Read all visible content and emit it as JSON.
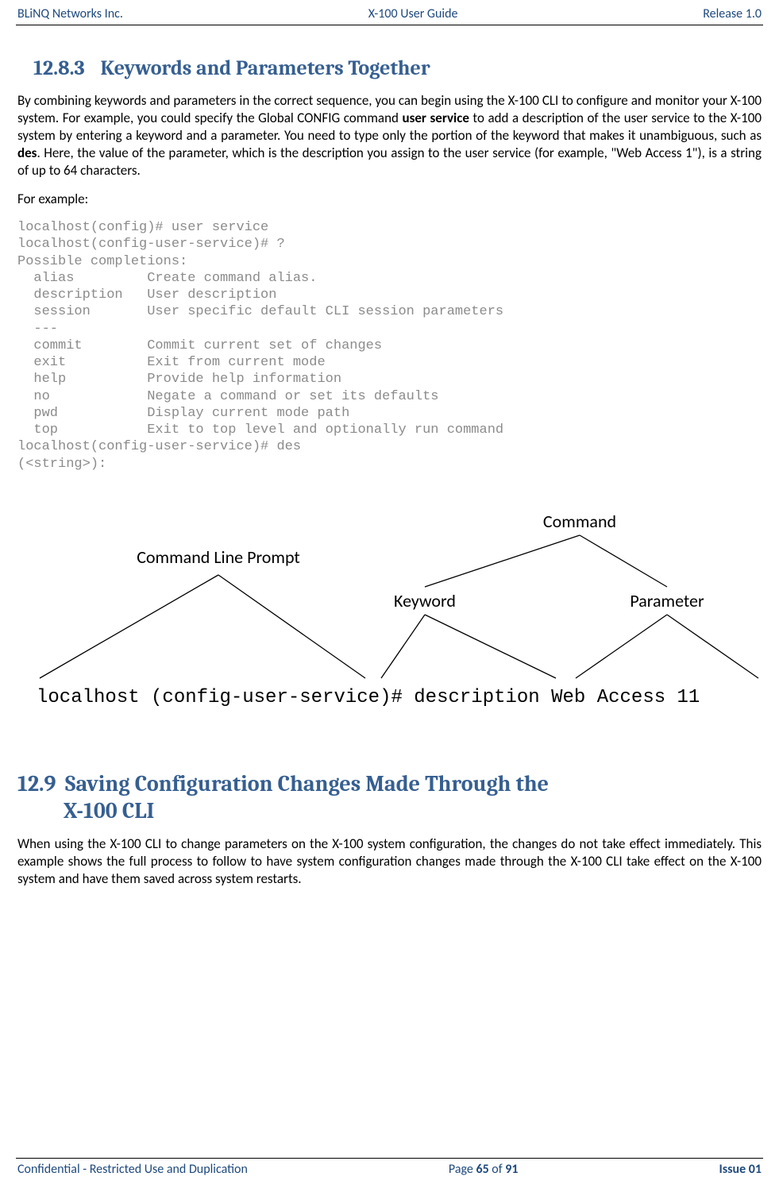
{
  "header": {
    "left": "BLiNQ Networks Inc.",
    "center": "X-100 User Guide",
    "right": "Release 1.0"
  },
  "section1": {
    "number": "12.8.3",
    "title": "Keywords and Parameters Together",
    "p1_a": "By combining keywords and parameters in the correct sequence, you can begin using the X-100 CLI to configure and monitor your X-100 system. For example, you could specify the Global CONFIG command ",
    "p1_b": "user service",
    "p1_c": " to add a description of the user service to the X-100 system by entering a keyword and a parameter. You need to type only the portion of the keyword that makes it unambiguous, such as ",
    "p1_d": "des",
    "p1_e": ". Here, the value of the parameter, which is the description you assign to the user service (for example, \"Web Access 1\"), is a string of up to 64 characters.",
    "p2": "For example:"
  },
  "cli_block": "localhost(config)# user service\nlocalhost(config-user-service)# ?\nPossible completions:\n  alias         Create command alias.\n  description   User description\n  session       User specific default CLI session parameters\n  ---\n  commit        Commit current set of changes\n  exit          Exit from current mode\n  help          Provide help information\n  no            Negate a command or set its defaults\n  pwd           Display current mode path\n  top           Exit to top level and optionally run command\nlocalhost(config-user-service)# des\n(<string>):",
  "diagram": {
    "label_prompt": "Command Line Prompt",
    "label_command": "Command",
    "label_keyword": "Keyword",
    "label_parameter": "Parameter",
    "cli_text": "localhost (config-user-service)# description Web Access 11"
  },
  "section2": {
    "number": "12.9",
    "title_line1": "Saving Configuration Changes Made Through the",
    "title_line2": "X-100 CLI",
    "p1": "When using the X-100 CLI to change parameters on the X-100 system configuration, the changes do not take effect immediately. This example shows the full process to follow to have system configuration changes made through the X-100 CLI take effect on the X-100 system and have them saved across system restarts."
  },
  "footer": {
    "left": "Confidential - Restricted Use and Duplication",
    "center_a": "Page ",
    "center_b": "65",
    "center_c": " of ",
    "center_d": "91",
    "right": "Issue 01"
  }
}
